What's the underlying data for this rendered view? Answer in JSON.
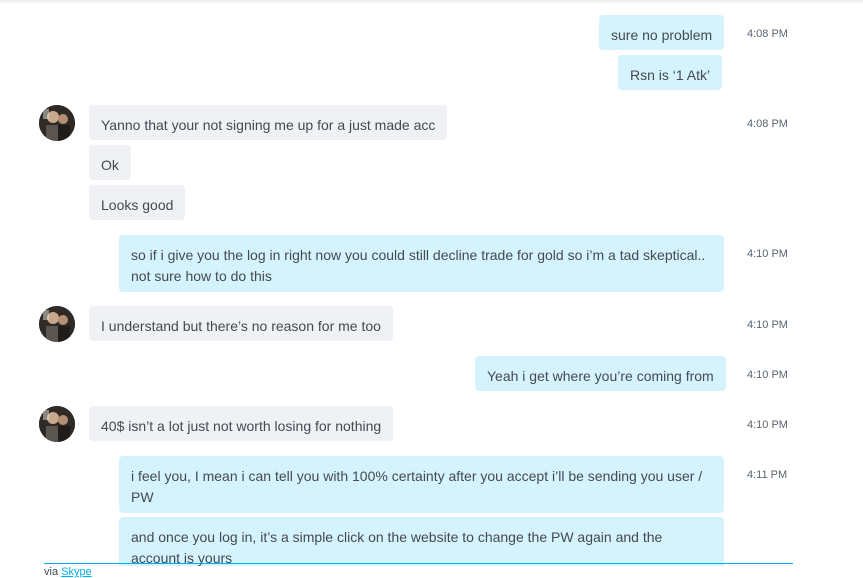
{
  "messages": [
    {
      "text": "sure no problem",
      "time": "4:08 PM"
    },
    {
      "text": "Rsn is ‘1 Atk’"
    },
    {
      "text": "Yanno that your not signing me up for a just made acc",
      "time": "4:08 PM"
    },
    {
      "text": "Ok"
    },
    {
      "text": "Looks good"
    },
    {
      "text": "so if i give you the log in right now you could still decline trade for gold so i’m a tad skeptical.. not sure how to do this",
      "time": "4:10 PM"
    },
    {
      "text": "I understand but there’s no reason for me too",
      "time": "4:10 PM"
    },
    {
      "text": "Yeah i get where you’re coming from",
      "time": "4:10 PM"
    },
    {
      "text": "40$ isn’t a lot just not worth losing for nothing",
      "time": "4:10 PM"
    },
    {
      "text": "i feel you, I mean i can tell you with 100% certainty after you accept i’ll be sending you user / PW",
      "time": "4:11 PM"
    },
    {
      "text": "and once you log in, it’s a simple click on the website to change the PW again and the account is yours"
    }
  ],
  "footer": {
    "via_text": "via",
    "link_text": "Skype"
  },
  "colors": {
    "outgoing_bubble": "#d5f3fd",
    "incoming_bubble": "#eff1f4",
    "accent": "#00aff0"
  }
}
